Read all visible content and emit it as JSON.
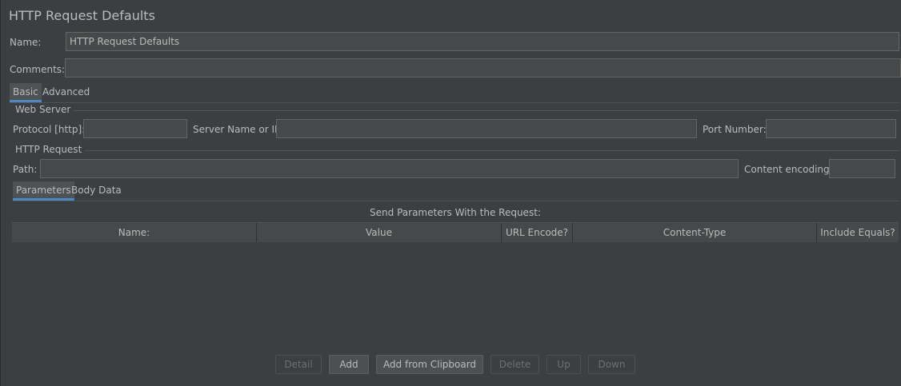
{
  "title": "HTTP Request Defaults",
  "name_label": "Name:",
  "name_value": "HTTP Request Defaults",
  "comments_label": "Comments:",
  "comments_value": "",
  "tabs": [
    {
      "label": "Basic",
      "active": true
    },
    {
      "label": "Advanced",
      "active": false
    }
  ],
  "web_server": {
    "section_title": "Web Server",
    "protocol_label": "Protocol [http]:",
    "protocol_value": "",
    "server_label": "Server Name or IP:",
    "server_value": "",
    "port_label": "Port Number:",
    "port_value": ""
  },
  "http_request": {
    "section_title": "HTTP Request",
    "path_label": "Path:",
    "path_value": "",
    "encoding_label": "Content encoding:",
    "encoding_value": ""
  },
  "sub_tabs": [
    {
      "label": "Parameters",
      "active": true
    },
    {
      "label": "Body Data",
      "active": false
    }
  ],
  "params_table": {
    "caption": "Send Parameters With the Request:",
    "columns": [
      "Name:",
      "Value",
      "URL Encode?",
      "Content-Type",
      "Include Equals?"
    ],
    "rows": []
  },
  "buttons": [
    {
      "label": "Detail",
      "enabled": false
    },
    {
      "label": "Add",
      "enabled": true
    },
    {
      "label": "Add from Clipboard",
      "enabled": true
    },
    {
      "label": "Delete",
      "enabled": false
    },
    {
      "label": "Up",
      "enabled": false
    },
    {
      "label": "Down",
      "enabled": false
    }
  ],
  "colors": {
    "background": "#3c3f41",
    "field_background": "#45494a",
    "accent": "#4a88c7",
    "text": "#bbbbbb",
    "disabled_text": "#6e6e6e"
  }
}
